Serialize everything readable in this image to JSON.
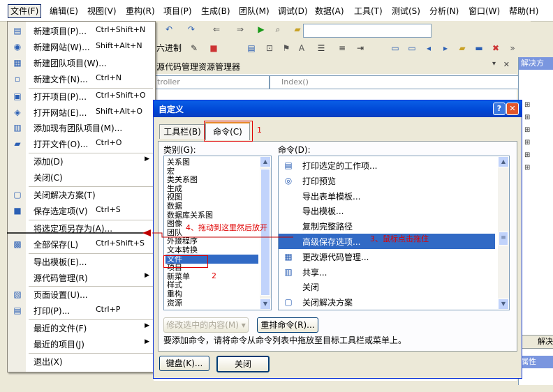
{
  "menubar": {
    "items": [
      "文件(F)",
      "编辑(E)",
      "视图(V)",
      "重构(R)",
      "项目(P)",
      "生成(B)",
      "团队(M)",
      "调试(D)",
      "数据(A)",
      "工具(T)",
      "测试(S)",
      "分析(N)",
      "窗口(W)",
      "帮助(H)"
    ]
  },
  "toolbar": {
    "hex_label": "六进制"
  },
  "doc_tab": {
    "title": "源代码管理资源管理器",
    "combo_left": "troller",
    "combo_right": "Index()"
  },
  "right_panel": {
    "title": "解决方",
    "bottom_tab": "解决",
    "bottom_label": "属性"
  },
  "file_menu": {
    "items": [
      {
        "label": "新建项目(P)...",
        "shortcut": "Ctrl+Shift+N",
        "icon": "new-project-icon",
        "glyph": "▤"
      },
      {
        "label": "新建网站(W)...",
        "shortcut": "Shift+Alt+N",
        "icon": "new-website-icon",
        "glyph": "◉"
      },
      {
        "label": "新建团队项目(W)...",
        "shortcut": "",
        "icon": "new-team-project-icon",
        "glyph": "▦"
      },
      {
        "label": "新建文件(N)...",
        "shortcut": "Ctrl+N",
        "icon": "new-file-icon",
        "glyph": "▫"
      },
      {
        "label": "打开项目(P)...",
        "shortcut": "Ctrl+Shift+O",
        "icon": "open-project-icon",
        "glyph": "▣"
      },
      {
        "label": "打开网站(E)...",
        "shortcut": "Shift+Alt+O",
        "icon": "open-website-icon",
        "glyph": "◈"
      },
      {
        "label": "添加现有团队项目(M)...",
        "shortcut": "",
        "icon": "add-team-project-icon",
        "glyph": "▥"
      },
      {
        "label": "打开文件(O)...",
        "shortcut": "Ctrl+O",
        "icon": "open-file-icon",
        "glyph": "▰"
      },
      {
        "label": "添加(D)",
        "shortcut": "",
        "icon": "",
        "glyph": "",
        "submenu": true
      },
      {
        "label": "关闭(C)",
        "shortcut": "",
        "icon": "",
        "glyph": ""
      },
      {
        "label": "关闭解决方案(T)",
        "shortcut": "",
        "icon": "close-solution-icon",
        "glyph": "▢"
      },
      {
        "label": "保存选定项(V)",
        "shortcut": "Ctrl+S",
        "icon": "save-icon",
        "glyph": "■"
      },
      {
        "label": "将选定项另存为(A)...",
        "shortcut": "",
        "icon": "",
        "glyph": ""
      },
      {
        "label": "全部保存(L)",
        "shortcut": "Ctrl+Shift+S",
        "icon": "save-all-icon",
        "glyph": "▩"
      },
      {
        "label": "导出模板(E)...",
        "shortcut": "",
        "icon": "",
        "glyph": ""
      },
      {
        "label": "源代码管理(R)",
        "shortcut": "",
        "icon": "",
        "glyph": "",
        "submenu": true
      },
      {
        "label": "页面设置(U)...",
        "shortcut": "",
        "icon": "page-setup-icon",
        "glyph": "▧"
      },
      {
        "label": "打印(P)...",
        "shortcut": "Ctrl+P",
        "icon": "print-icon",
        "glyph": "▤"
      },
      {
        "label": "最近的文件(F)",
        "shortcut": "",
        "icon": "",
        "glyph": "",
        "submenu": true
      },
      {
        "label": "最近的项目(J)",
        "shortcut": "",
        "icon": "",
        "glyph": "",
        "submenu": true
      },
      {
        "label": "退出(X)",
        "shortcut": "",
        "icon": "",
        "glyph": ""
      }
    ]
  },
  "dialog": {
    "title": "自定义",
    "help_btn": "?",
    "close_btn": "✕",
    "tabs": [
      "工具栏(B)",
      "命令(C)"
    ],
    "categories_label": "类别(G):",
    "commands_label": "命令(D):",
    "categories": [
      "关系图",
      "宏",
      "类关系图",
      "生成",
      "视图",
      "数据",
      "数据库关系图",
      "图像",
      "团队",
      "外接程序",
      "文本转换",
      "文件",
      "项目",
      "新菜单",
      "样式",
      "重构",
      "资源"
    ],
    "selected_category": "文件",
    "commands": [
      {
        "label": "打印选定的工作项...",
        "icon": "print-workitem-icon",
        "glyph": "▤"
      },
      {
        "label": "打印预览",
        "icon": "print-preview-icon",
        "glyph": "◎"
      },
      {
        "label": "导出表单模板...",
        "icon": "",
        "glyph": ""
      },
      {
        "label": "导出模板...",
        "icon": "",
        "glyph": ""
      },
      {
        "label": "复制完整路径",
        "icon": "",
        "glyph": ""
      },
      {
        "label": "高级保存选项...",
        "icon": "",
        "glyph": "",
        "selected": true
      },
      {
        "label": "更改源代码管理...",
        "icon": "source-control-icon",
        "glyph": "▦"
      },
      {
        "label": "共享...",
        "icon": "share-icon",
        "glyph": "▥"
      },
      {
        "label": "关闭",
        "icon": "",
        "glyph": ""
      },
      {
        "label": "关闭解决方案",
        "icon": "close-solution-cmd-icon",
        "glyph": "▢"
      }
    ],
    "modify_btn": "修改选中的内容(M) ▾",
    "rearrange_btn": "重排命令(R)...",
    "hint": "要添加命令，请将命令从命令列表中拖放至目标工具栏或菜单上。",
    "keyboard_btn": "键盘(K)...",
    "close_button": "关闭"
  },
  "annotations": {
    "n1": "1",
    "n2": "2",
    "n3": "3、鼠标点击拖住",
    "n4": "4、拖动到这里然后放开"
  },
  "colors": {
    "selection": "#316ac5",
    "title_bar": "#0046d5",
    "annotation_red": "#e00000"
  }
}
